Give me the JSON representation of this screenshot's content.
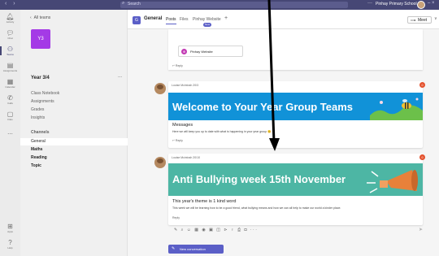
{
  "titlebar": {
    "nav_icon": "back-forward-arrows",
    "search_placeholder": "Search",
    "more_icon": "ellipsis",
    "org_name": "Pinhay Primary School",
    "window_controls": "–  ×"
  },
  "appbar": {
    "items": [
      {
        "icon": "bell",
        "label": "Activity"
      },
      {
        "icon": "chat",
        "label": "Chat"
      },
      {
        "icon": "teams",
        "label": "Teams"
      },
      {
        "icon": "assignments",
        "label": "Assignments"
      },
      {
        "icon": "calendar",
        "label": "Calendar"
      },
      {
        "icon": "calls",
        "label": "Calls"
      },
      {
        "icon": "files",
        "label": "Files"
      },
      {
        "icon": "more",
        "label": "..."
      },
      {
        "icon": "apps",
        "label": "Apps"
      },
      {
        "icon": "help",
        "label": "Help"
      }
    ]
  },
  "sidebar": {
    "back_label": "All teams",
    "team_tile": "Y3",
    "team_name": "Year 3/4",
    "team_more": "...",
    "links": [
      "Class Notebook",
      "Assignments",
      "Grades",
      "Insights"
    ],
    "channels_heading": "Channels",
    "channels": [
      "General",
      "Maths",
      "Reading",
      "Topic"
    ]
  },
  "header": {
    "channel_name": "General",
    "tabs": [
      "Posts",
      "Files",
      "Pinhay Website"
    ],
    "new_badge": "New",
    "add_tab": "+",
    "meet_label": "Meet",
    "meet_chevron": "∨"
  },
  "feed": {
    "pinned_tab_label": "Pinhay Website",
    "reply_label": "Reply",
    "posts": [
      {
        "author": "Louise Mcintosh 20/3",
        "banner_text": "Welcome to Your Year Group Teams",
        "title": "Messages",
        "body": "Here we will keep you up to date with what is happening in your year group 😊",
        "reply": "Reply"
      },
      {
        "author": "Louise Mcintosh 20/10",
        "banner_text": "Anti Bullying week 15th November",
        "title": "This year's theme is 1 kind word",
        "body": "This week we will be learning how to be a good friend, what bullying means and how we can all help to make our world a kinder place.",
        "reply": "Reply"
      }
    ],
    "composer_icons": "✎ ⌕ ☺ ▦ ◉ ▣ ◫ ⊳ ♀ ⎙ ◘ ···",
    "send_icon": "➤",
    "new_conversation": "New conversation"
  },
  "colors": {
    "titlebar": "#464775",
    "accent": "#5b5fc7",
    "team_tile": "#a43ae6",
    "banner_blue": "#1192d8",
    "banner_teal": "#4db6a4",
    "badge_red": "#e4522e"
  }
}
